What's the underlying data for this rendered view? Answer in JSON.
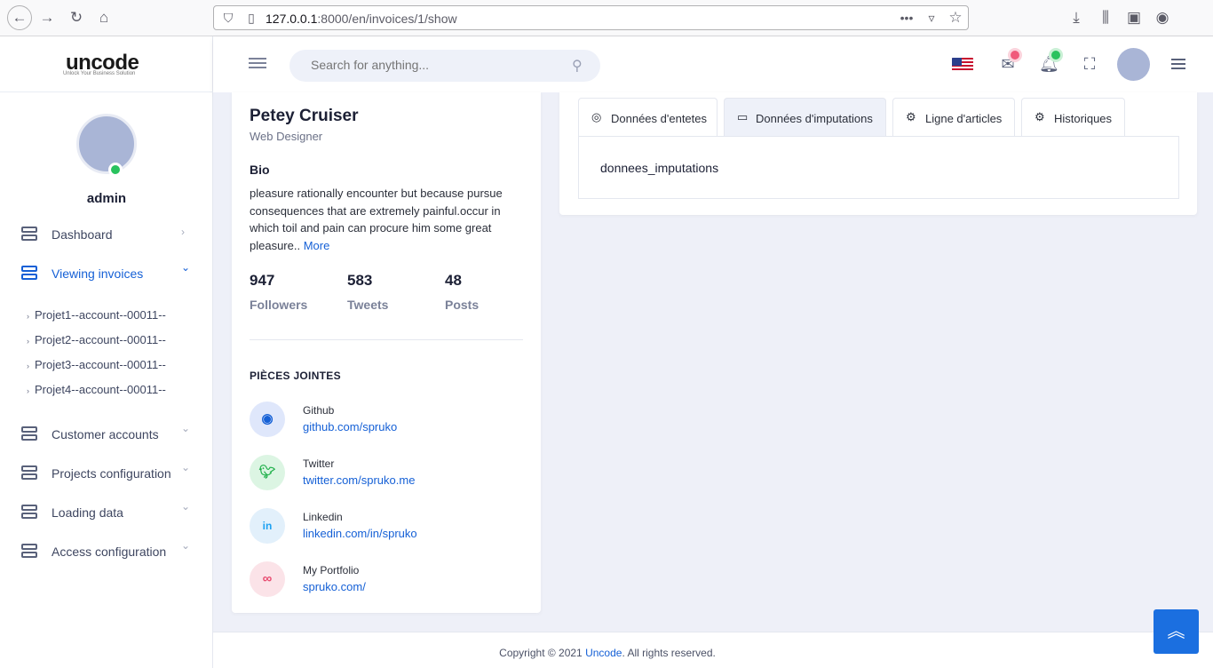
{
  "browser": {
    "url_host": "127.0.0.1",
    "url_rest": ":8000/en/invoices/1/show",
    "icons": [
      "back-icon",
      "forward-icon",
      "reload-icon",
      "home-icon",
      "shield-icon",
      "page-icon",
      "more-icon",
      "pocket-icon",
      "star-icon",
      "download-icon",
      "library-icon",
      "sidebar-icon",
      "account-icon"
    ]
  },
  "sidebar": {
    "logo_text": "uncode",
    "logo_tagline": "Unlock Your Business Solution",
    "username": "admin",
    "items": [
      {
        "label": "Dashboard",
        "chevron": "›"
      },
      {
        "label": "Viewing invoices",
        "chevron": "⌄"
      },
      {
        "label": "Customer accounts",
        "chevron": "⌄"
      },
      {
        "label": "Projects configuration",
        "chevron": "⌄"
      },
      {
        "label": "Loading data",
        "chevron": "⌄"
      },
      {
        "label": "Access configuration",
        "chevron": "⌄"
      }
    ],
    "subitems": [
      {
        "label": "Projet1--account--00011--"
      },
      {
        "label": "Projet2--account--00011--"
      },
      {
        "label": "Projet3--account--00011--"
      },
      {
        "label": "Projet4--account--00011--"
      }
    ]
  },
  "header": {
    "search_placeholder": "Search for anything...",
    "accent_color": "#1560d6"
  },
  "profile": {
    "name": "Petey Cruiser",
    "role": "Web Designer",
    "bio_heading": "Bio",
    "bio_text": "pleasure rationally encounter but because pursue consequences that are extremely painful.occur in which toil and pain can procure him some great pleasure.. ",
    "bio_more": "More",
    "stats": [
      {
        "value": "947",
        "label": "Followers"
      },
      {
        "value": "583",
        "label": "Tweets"
      },
      {
        "value": "48",
        "label": "Posts"
      }
    ],
    "attachments_heading": "PIÈCES JOINTES",
    "links": [
      {
        "title": "Github",
        "url": "github.com/spruko",
        "icon": "github-icon"
      },
      {
        "title": "Twitter",
        "url": "twitter.com/spruko.me",
        "icon": "twitter-icon"
      },
      {
        "title": "Linkedin",
        "url": "linkedin.com/in/spruko",
        "icon": "linkedin-icon"
      },
      {
        "title": "My Portfolio",
        "url": "spruko.com/",
        "icon": "link-icon"
      }
    ]
  },
  "tabs": [
    {
      "label": "Données d'entetes",
      "icon": "user-circle-icon"
    },
    {
      "label": "Données d'imputations",
      "icon": "monitor-icon"
    },
    {
      "label": "Ligne d'articles",
      "icon": "gear-icon"
    },
    {
      "label": "Historiques",
      "icon": "gear-icon"
    }
  ],
  "tab_content": "donnees_imputations",
  "footer": {
    "prefix": "Copyright © 2021 ",
    "brand": "Uncode",
    "suffix": ". All rights reserved."
  }
}
